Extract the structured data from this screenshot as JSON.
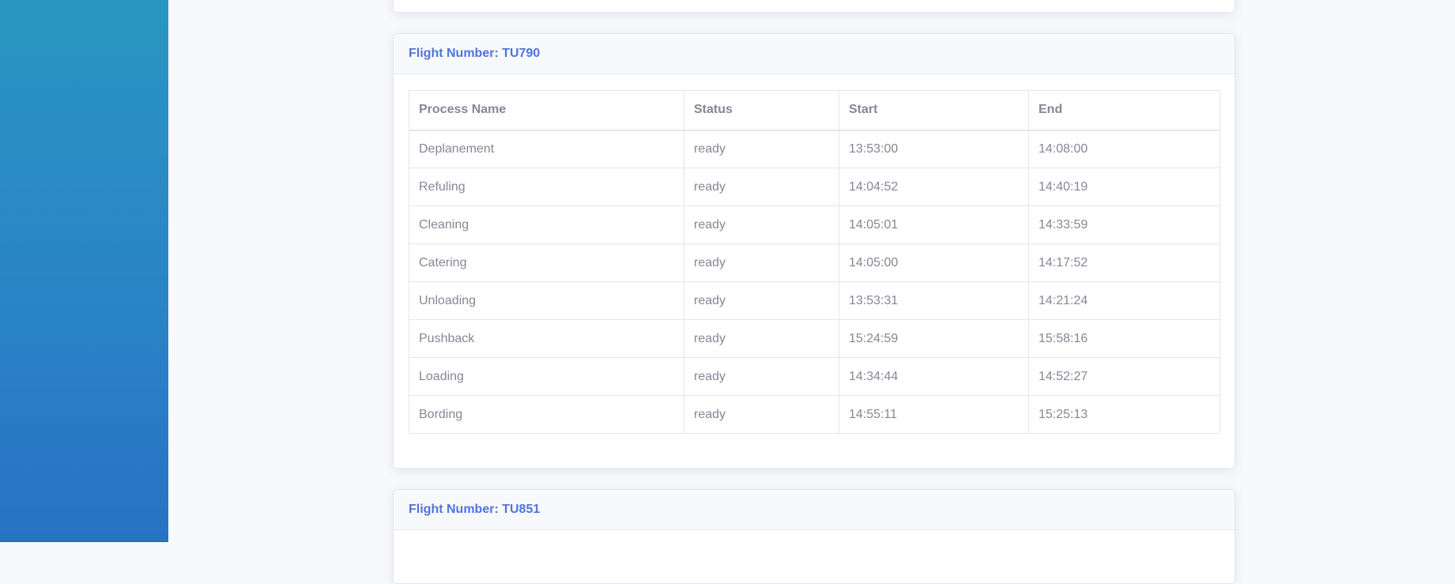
{
  "flight_tu790": {
    "title": "Flight Number: TU790",
    "columns": [
      "Process Name",
      "Status",
      "Start",
      "End"
    ],
    "rows": [
      [
        "Deplanement",
        "ready",
        "13:53:00",
        "14:08:00"
      ],
      [
        "Refuling",
        "ready",
        "14:04:52",
        "14:40:19"
      ],
      [
        "Cleaning",
        "ready",
        "14:05:01",
        "14:33:59"
      ],
      [
        "Catering",
        "ready",
        "14:05:00",
        "14:17:52"
      ],
      [
        "Unloading",
        "ready",
        "13:53:31",
        "14:21:24"
      ],
      [
        "Pushback",
        "ready",
        "15:24:59",
        "15:58:16"
      ],
      [
        "Loading",
        "ready",
        "14:34:44",
        "14:52:27"
      ],
      [
        "Bording",
        "ready",
        "14:55:11",
        "15:25:13"
      ]
    ]
  },
  "flight_tu851": {
    "title": "Flight Number: TU851"
  },
  "colors": {
    "sidebar_top": "#2996c1",
    "sidebar_bottom": "#2872c4",
    "accent": "#4e73df",
    "text_muted": "#858796"
  }
}
